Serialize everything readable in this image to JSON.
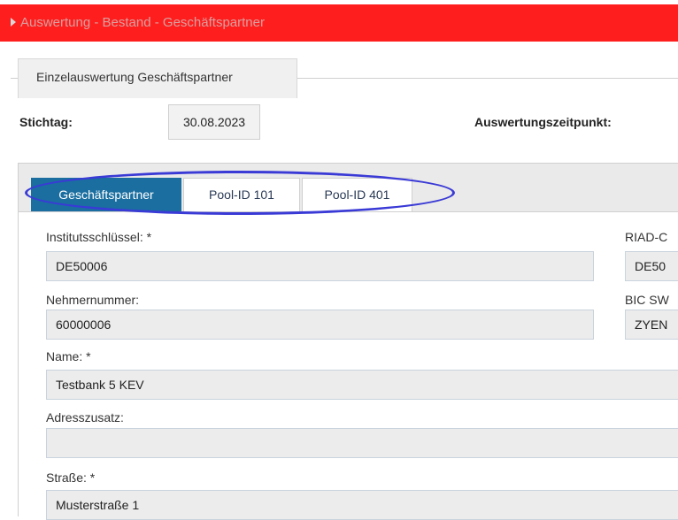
{
  "header": {
    "title": "Auswertung - Bestand - Geschäftspartner"
  },
  "section": {
    "legend": "Einzelauswertung Geschäftspartner"
  },
  "stichtag": {
    "label": "Stichtag:",
    "value": "30.08.2023"
  },
  "auswertungszeitpunkt": {
    "label": "Auswertungszeitpunkt:"
  },
  "tabs": [
    {
      "label": "Geschäftspartner",
      "active": true
    },
    {
      "label": "Pool-ID 101",
      "active": false
    },
    {
      "label": "Pool-ID 401",
      "active": false
    }
  ],
  "form": {
    "institutsschluessel": {
      "label": "Institutsschlüssel:  *",
      "value": "DE50006"
    },
    "riad": {
      "label": "RIAD-C",
      "value": "DE50"
    },
    "nehmernummer": {
      "label": "Nehmernummer:",
      "value": "60000006"
    },
    "bic": {
      "label": "BIC SW",
      "value": "ZYEN"
    },
    "name": {
      "label": "Name:  *",
      "value": "Testbank 5 KEV"
    },
    "adresszusatz": {
      "label": "Adresszusatz:",
      "value": ""
    },
    "strasse": {
      "label": "Straße:  *",
      "value": "Musterstraße 1"
    }
  },
  "colors": {
    "header_bg": "#ff1e1e",
    "active_tab": "#1a6ea0",
    "annotation": "#3a3ad6"
  }
}
